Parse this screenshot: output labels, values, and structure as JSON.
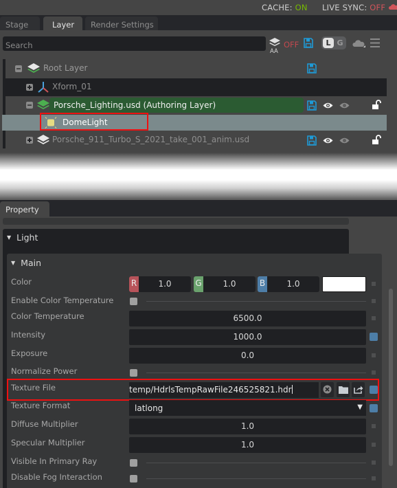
{
  "status_bar": {
    "cache_label": "CACHE:",
    "cache_value": "ON",
    "live_sync_label": "LIVE SYNC:",
    "live_sync_value": "OFF",
    "live_sync_icon": "cloud-icon",
    "colors": {
      "on": "#76b900",
      "off": "#d0545a"
    }
  },
  "tabs": [
    {
      "label": "Stage",
      "active": false
    },
    {
      "label": "Layer",
      "active": true
    },
    {
      "label": "Render Settings",
      "active": false
    }
  ],
  "layer_toolbar": {
    "search_placeholder": "Search",
    "auto_authoring_label": "AA",
    "auto_authoring_state": "OFF",
    "save_icon": "save-icon",
    "toggle_left": "L",
    "toggle_right": "G",
    "cloud_icon": "cloud-icon",
    "menu_icon": "hamburger-menu-icon"
  },
  "layer_tree": {
    "rows": [
      {
        "label": "Root Layer",
        "expander": "collapse",
        "icon": "layers-icon",
        "save": true,
        "visibility": false,
        "lock": false
      },
      {
        "label": "Xform_01",
        "expander": "expand",
        "icon": "xform-axes-icon",
        "save": false,
        "visibility": false,
        "lock": false
      },
      {
        "label": "Porsche_Lighting.usd (Authoring Layer)",
        "expander": "collapse",
        "icon": "layers-icon",
        "save": true,
        "visibility": true,
        "lock": true,
        "authoring": true
      },
      {
        "label": "DomeLight",
        "expander": null,
        "icon": "dome-light-icon",
        "selected": true
      },
      {
        "label": "Porsche_911_Turbo_S_2021_take_001_anim.usd",
        "expander": "expand",
        "icon": "layers-icon",
        "save": true,
        "visibility": true,
        "lock": true
      }
    ]
  },
  "property_panel": {
    "tab_label": "Property",
    "section": "Light",
    "subsection": "Main",
    "properties": {
      "color": {
        "label": "Color",
        "r_tag": "R",
        "r": "1.0",
        "g_tag": "G",
        "g": "1.0",
        "b_tag": "B",
        "b": "1.0",
        "swatch": "#ffffff"
      },
      "enable_color_temperature": {
        "label": "Enable Color Temperature",
        "checked": false
      },
      "color_temperature": {
        "label": "Color Temperature",
        "value": "6500.0"
      },
      "intensity": {
        "label": "Intensity",
        "value": "1000.0",
        "authored": true
      },
      "exposure": {
        "label": "Exposure",
        "value": "0.0"
      },
      "normalize_power": {
        "label": "Normalize Power",
        "checked": false
      },
      "texture_file": {
        "label": "Texture File",
        "value": "temp/HdrlsTempRawFile246525821.hdr",
        "authored": true
      },
      "texture_format": {
        "label": "Texture Format",
        "value": "latlong",
        "authored": true
      },
      "diffuse_multiplier": {
        "label": "Diffuse Multiplier",
        "value": "1.0"
      },
      "specular_multiplier": {
        "label": "Specular Multiplier",
        "value": "1.0"
      },
      "visible_in_primary_ray": {
        "label": "Visible In Primary Ray",
        "checked": false
      },
      "disable_fog_interaction": {
        "label": "Disable Fog Interaction",
        "checked": false
      }
    }
  },
  "colors": {
    "accent_blue": "#4d7ea7",
    "authoring_green": "#2b5b32",
    "highlight_red": "#ee1111",
    "channel_r": "#b7535a",
    "channel_g": "#6aa26d",
    "channel_b": "#4e7ea8"
  }
}
